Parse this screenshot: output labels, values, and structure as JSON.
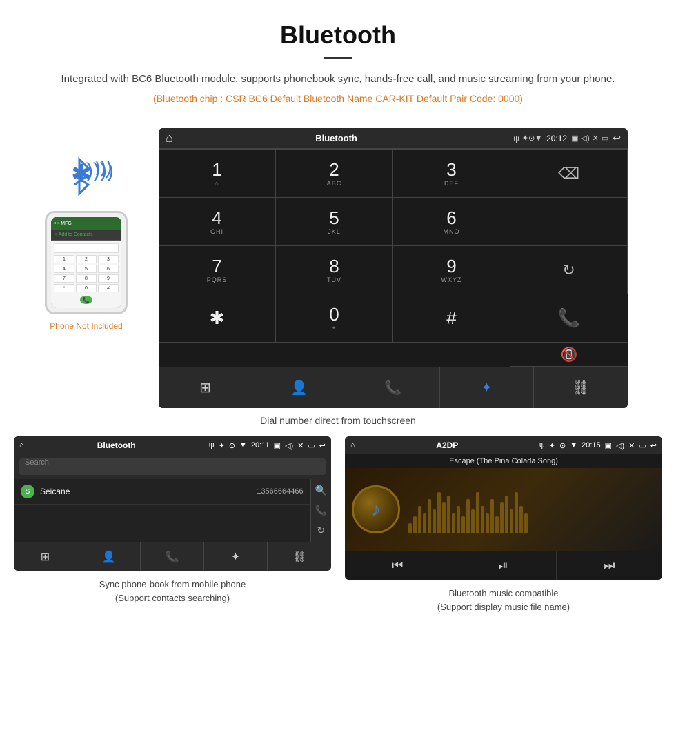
{
  "header": {
    "title": "Bluetooth",
    "description": "Integrated with BC6 Bluetooth module, supports phonebook sync, hands-free call, and music streaming from your phone.",
    "specs": "(Bluetooth chip : CSR BC6    Default Bluetooth Name CAR-KIT    Default Pair Code: 0000)"
  },
  "dialer_screen": {
    "status_bar": {
      "home_icon": "home",
      "title": "Bluetooth",
      "usb_icon": "usb",
      "time": "20:12",
      "back_icon": "back"
    },
    "keys": [
      {
        "num": "1",
        "sub": "⌂"
      },
      {
        "num": "2",
        "sub": "ABC"
      },
      {
        "num": "3",
        "sub": "DEF"
      },
      {
        "num": "",
        "sub": ""
      },
      {
        "num": "4",
        "sub": "GHI"
      },
      {
        "num": "5",
        "sub": "JKL"
      },
      {
        "num": "6",
        "sub": "MNO"
      },
      {
        "num": "",
        "sub": ""
      },
      {
        "num": "7",
        "sub": "PQRS"
      },
      {
        "num": "8",
        "sub": "TUV"
      },
      {
        "num": "9",
        "sub": "WXYZ"
      },
      {
        "num": "↻",
        "sub": ""
      },
      {
        "num": "✱",
        "sub": ""
      },
      {
        "num": "0",
        "sub": "+"
      },
      {
        "num": "#",
        "sub": ""
      },
      {
        "num": "📞",
        "sub": ""
      },
      {
        "num": "📵",
        "sub": ""
      }
    ]
  },
  "dial_caption": "Dial number direct from touchscreen",
  "phone_not_included": "Phone Not Included",
  "phonebook": {
    "title": "Bluetooth",
    "search_placeholder": "Search",
    "contact_name": "Seicane",
    "contact_number": "13566664466"
  },
  "phonebook_caption": "Sync phone-book from mobile phone\n(Support contacts searching)",
  "music": {
    "title": "A2DP",
    "track_name": "Escape (The Pina Colada Song)",
    "time": "20:15"
  },
  "music_caption": "Bluetooth music compatible\n(Support display music file name)",
  "colors": {
    "accent_orange": "#e07820",
    "android_dark": "#1a1a1a",
    "android_statusbar": "#2a2a2a",
    "call_green": "#4caf50",
    "call_red": "#e53935",
    "bluetooth_blue": "#3a7bd5"
  },
  "visualizer_bars": [
    15,
    25,
    40,
    30,
    50,
    35,
    60,
    45,
    55,
    30,
    40,
    25,
    50,
    35,
    60,
    40,
    30,
    50,
    25,
    45,
    55,
    35,
    60,
    40,
    30
  ]
}
